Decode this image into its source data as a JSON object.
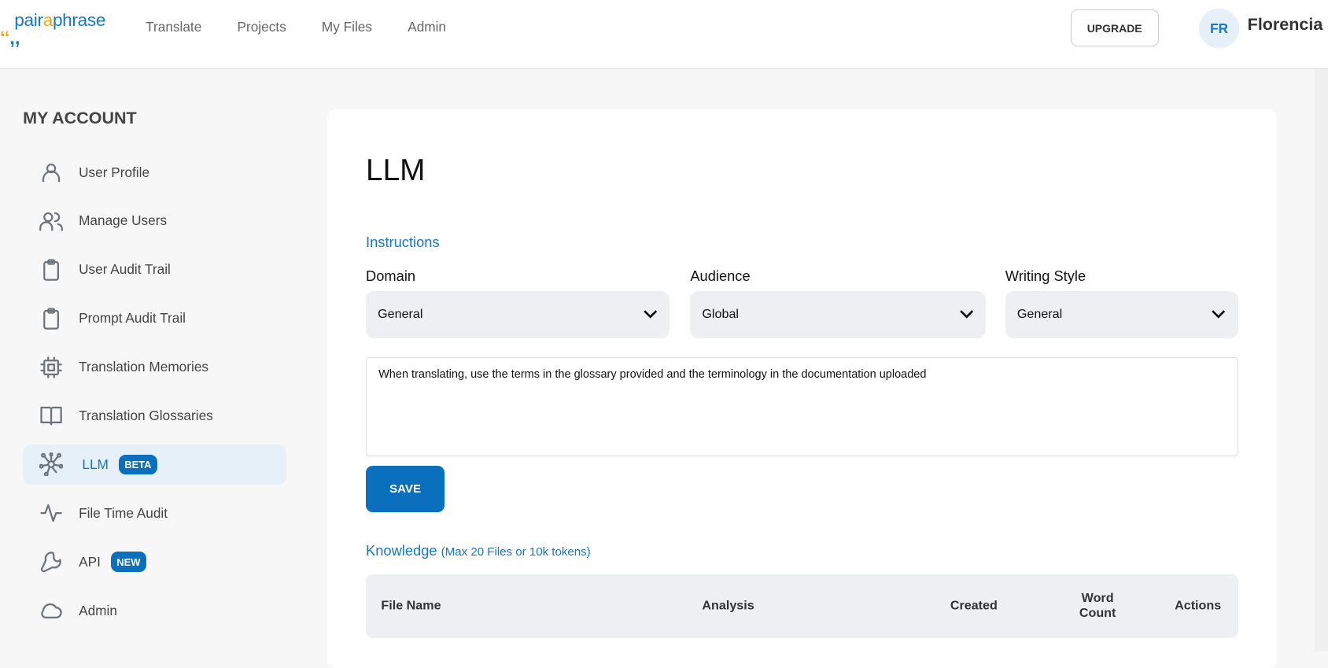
{
  "header": {
    "logo": "pairaphrase",
    "nav": [
      "Translate",
      "Projects",
      "My Files",
      "Admin"
    ],
    "upgrade": "UPGRADE",
    "avatar_initials": "FR",
    "user_name": "Florencia"
  },
  "sidebar": {
    "title": "MY ACCOUNT",
    "items": [
      {
        "label": "User Profile",
        "icon": "user-icon"
      },
      {
        "label": "Manage Users",
        "icon": "users-icon"
      },
      {
        "label": "User Audit Trail",
        "icon": "clipboard-icon"
      },
      {
        "label": "Prompt Audit Trail",
        "icon": "clipboard-icon"
      },
      {
        "label": "Translation Memories",
        "icon": "chip-icon"
      },
      {
        "label": "Translation Glossaries",
        "icon": "book-icon"
      },
      {
        "label": "LLM",
        "icon": "network-icon",
        "badge": "BETA",
        "active": true
      },
      {
        "label": "File Time Audit",
        "icon": "activity-icon"
      },
      {
        "label": "API",
        "icon": "wrench-icon",
        "badge": "NEW"
      },
      {
        "label": "Admin",
        "icon": "cloud-icon"
      }
    ]
  },
  "main": {
    "title": "LLM",
    "instructions_label": "Instructions",
    "fields": [
      {
        "label": "Domain",
        "value": "General"
      },
      {
        "label": "Audience",
        "value": "Global"
      },
      {
        "label": "Writing Style",
        "value": "General"
      }
    ],
    "instructions_text": "When translating, use the terms in the glossary provided and the terminology in the documentation uploaded",
    "save": "SAVE",
    "knowledge_label": "Knowledge",
    "knowledge_note": "(Max 20 Files or 10k tokens)",
    "table_headers": [
      "File Name",
      "Analysis",
      "Created",
      "Word Count",
      "Actions"
    ]
  },
  "colors": {
    "accent": "#0a70bd",
    "link": "#1676c7",
    "logo_orange": "#f7a21b"
  }
}
